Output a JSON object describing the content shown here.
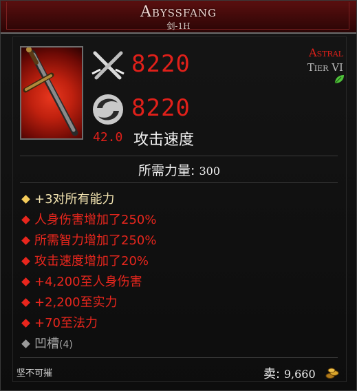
{
  "item": {
    "name": "Abyssfang",
    "subtitle": "剑-1H",
    "rarity": "Astral",
    "tier": "Tier VI",
    "physical_damage": "8220",
    "elemental_damage": "8220",
    "attack_speed_value": "42.0",
    "attack_speed_label": "攻击速度"
  },
  "requirement": {
    "label": "所需力量:",
    "value": "300"
  },
  "affixes": [
    {
      "type": "implicit",
      "text": "+3对所有能力"
    },
    {
      "type": "mod",
      "text": "人身伤害增加了250%"
    },
    {
      "type": "mod",
      "text": "所需智力增加了250%"
    },
    {
      "type": "mod",
      "text": "攻击速度增加了20%"
    },
    {
      "type": "mod",
      "text": "+4,200至人身伤害"
    },
    {
      "type": "mod",
      "text": "+2,200至实力"
    },
    {
      "type": "mod",
      "text": "+70至法力"
    }
  ],
  "socket": {
    "label": "凹槽",
    "count": "(4)"
  },
  "footer": {
    "flag": "坚不可摧",
    "sell_label": "卖:",
    "sell_value": "9,660"
  },
  "icons": {
    "physical": "crossed-swords-icon",
    "elemental": "swirl-orb-icon",
    "tier": "leaf-icon",
    "currency": "gold-coins-icon"
  },
  "colors": {
    "title_bar": "#5a0f0f",
    "damage": "#e0201a",
    "implicit": "#f5cc5a",
    "mod": "#e8261d",
    "socket": "#9a9a9a"
  }
}
